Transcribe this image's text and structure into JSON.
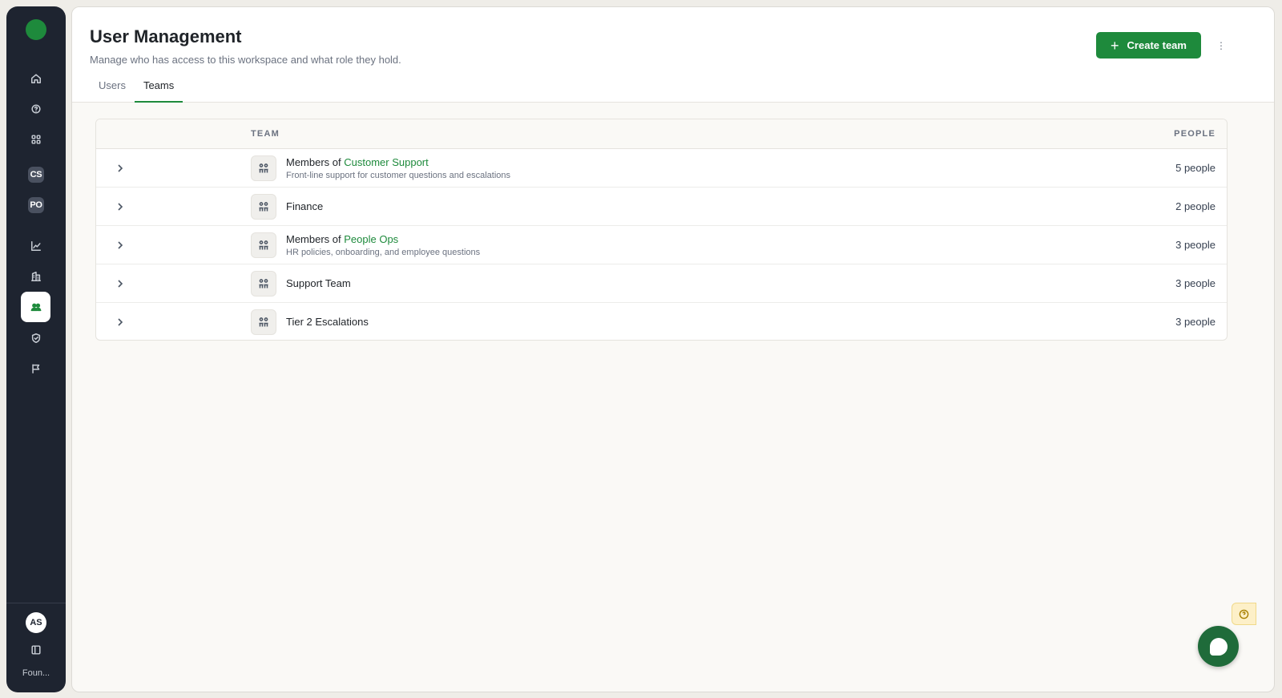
{
  "sidebar": {
    "workspaces": [
      {
        "label": "CS"
      },
      {
        "label": "PO"
      }
    ],
    "user_initials": "AS",
    "org_name": "Foun..."
  },
  "header": {
    "title": "User Management",
    "subtitle": "Manage who has access to this workspace and what role they hold.",
    "tabs": [
      {
        "label": "Users",
        "active": false
      },
      {
        "label": "Teams",
        "active": true
      }
    ],
    "create_button": "Create team"
  },
  "table": {
    "columns": {
      "team": "TEAM",
      "people": "PEOPLE"
    },
    "rows": [
      {
        "prefix": "Members of ",
        "name": "Customer Support",
        "description": "Front-line support for customer questions and escalations",
        "people": "5 people"
      },
      {
        "prefix": "",
        "name": "Finance",
        "description": "",
        "people": "2 people"
      },
      {
        "prefix": "Members of ",
        "name": "People Ops",
        "description": "HR policies, onboarding, and employee questions",
        "people": "3 people"
      },
      {
        "prefix": "",
        "name": "Support Team",
        "description": "",
        "people": "3 people"
      },
      {
        "prefix": "",
        "name": "Tier 2 Escalations",
        "description": "",
        "people": "3 people"
      }
    ]
  },
  "colors": {
    "accent": "#1e8a3c",
    "sidebar_bg": "#1e2430",
    "chat_bg": "#1f6b3a"
  },
  "icons": {
    "nav": [
      "home-icon",
      "help-headset-icon",
      "apps-grid-icon",
      "analytics-chart-icon",
      "building-icon",
      "users-icon",
      "shield-icon",
      "flag-icon"
    ],
    "team_row": "team-grid-icon",
    "row_toggle": "chevron-right-icon"
  }
}
